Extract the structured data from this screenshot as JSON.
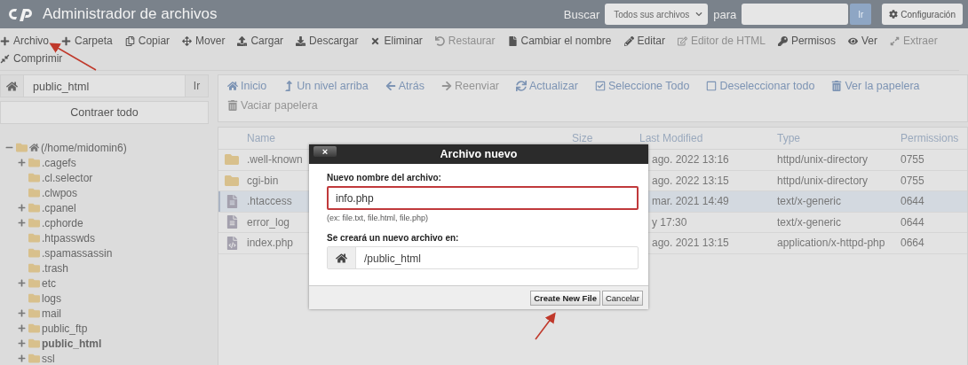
{
  "header": {
    "title": "Administrador de archivos",
    "search_label": "Buscar",
    "search_scope": "Todos sus archivos",
    "for_label": "para",
    "go_button": "Ir",
    "settings_button": "Configuración"
  },
  "toolbar": [
    {
      "label": "Archivo",
      "disabled": false
    },
    {
      "label": "Carpeta",
      "disabled": false
    },
    {
      "label": "Copiar",
      "disabled": false
    },
    {
      "label": "Mover",
      "disabled": false
    },
    {
      "label": "Cargar",
      "disabled": false
    },
    {
      "label": "Descargar",
      "disabled": false
    },
    {
      "label": "Eliminar",
      "disabled": false
    },
    {
      "label": "Restaurar",
      "disabled": true
    },
    {
      "label": "Cambiar el nombre",
      "disabled": false
    },
    {
      "label": "Editar",
      "disabled": false
    },
    {
      "label": "Editor de HTML",
      "disabled": true
    },
    {
      "label": "Permisos",
      "disabled": false
    },
    {
      "label": "Ver",
      "disabled": false
    },
    {
      "label": "Extraer",
      "disabled": true
    },
    {
      "label": "Comprimir",
      "disabled": false
    }
  ],
  "path_bar": {
    "value": "public_html",
    "go_button": "Ir"
  },
  "collapse_button": "Contraer todo",
  "tree": [
    {
      "label": "(/home/midomin6)",
      "expanded": true,
      "current": false,
      "children": [
        {
          "label": ".cagefs",
          "expanded": false,
          "current": false
        },
        {
          "label": ".cl.selector",
          "current": false
        },
        {
          "label": ".clwpos",
          "current": false
        },
        {
          "label": ".cpanel",
          "expanded": false,
          "current": false
        },
        {
          "label": ".cphorde",
          "expanded": false,
          "current": false
        },
        {
          "label": ".htpasswds",
          "current": false
        },
        {
          "label": ".spamassassin",
          "current": false
        },
        {
          "label": ".trash",
          "current": false
        },
        {
          "label": "etc",
          "expanded": false,
          "current": false
        },
        {
          "label": "logs",
          "current": false
        },
        {
          "label": "mail",
          "expanded": false,
          "current": false
        },
        {
          "label": "public_ftp",
          "expanded": false,
          "current": false
        },
        {
          "label": "public_html",
          "expanded": false,
          "current": true
        },
        {
          "label": "ssl",
          "expanded": false,
          "current": false
        }
      ]
    }
  ],
  "nav": [
    {
      "label": "Inicio",
      "disabled": false
    },
    {
      "label": "Un nivel arriba",
      "disabled": false
    },
    {
      "label": "Atrás",
      "disabled": false
    },
    {
      "label": "Reenviar",
      "disabled": true
    },
    {
      "label": "Actualizar",
      "disabled": false
    },
    {
      "label": "Seleccione Todo",
      "disabled": false
    },
    {
      "label": "Deseleccionar todo",
      "disabled": false
    },
    {
      "label": "Ver la papelera",
      "disabled": false
    },
    {
      "label": "Vaciar papelera",
      "disabled": true
    }
  ],
  "table": {
    "columns": [
      "Name",
      "Size",
      "Last Modified",
      "Type",
      "Permissions"
    ],
    "rows": [
      {
        "kind": "folder",
        "name": ".well-known",
        "modified": "ago. 2022 13:16",
        "type": "httpd/unix-directory",
        "permissions": "0755",
        "selected": false
      },
      {
        "kind": "folder",
        "name": "cgi-bin",
        "modified": "ago. 2022 13:15",
        "type": "httpd/unix-directory",
        "permissions": "0755",
        "selected": false
      },
      {
        "kind": "text",
        "name": ".htaccess",
        "modified": "mar. 2021 14:49",
        "type": "text/x-generic",
        "permissions": "0644",
        "selected": true
      },
      {
        "kind": "text",
        "name": "error_log",
        "modified": "y 17:30",
        "type": "text/x-generic",
        "permissions": "0644",
        "selected": false
      },
      {
        "kind": "code",
        "name": "index.php",
        "modified": "ago. 2021 13:15",
        "type": "application/x-httpd-php",
        "permissions": "0664",
        "selected": false
      }
    ]
  },
  "dialog": {
    "title": "Archivo nuevo",
    "close": "×",
    "name_label": "Nuevo nombre del archivo:",
    "name_value": "info.php",
    "name_hint": "(ex: file.txt, file.html, file.php)",
    "dir_label": "Se creará un nuevo archivo en:",
    "dir_value": "/public_html",
    "buttons": [
      "Create New File",
      "Cancelar"
    ]
  }
}
